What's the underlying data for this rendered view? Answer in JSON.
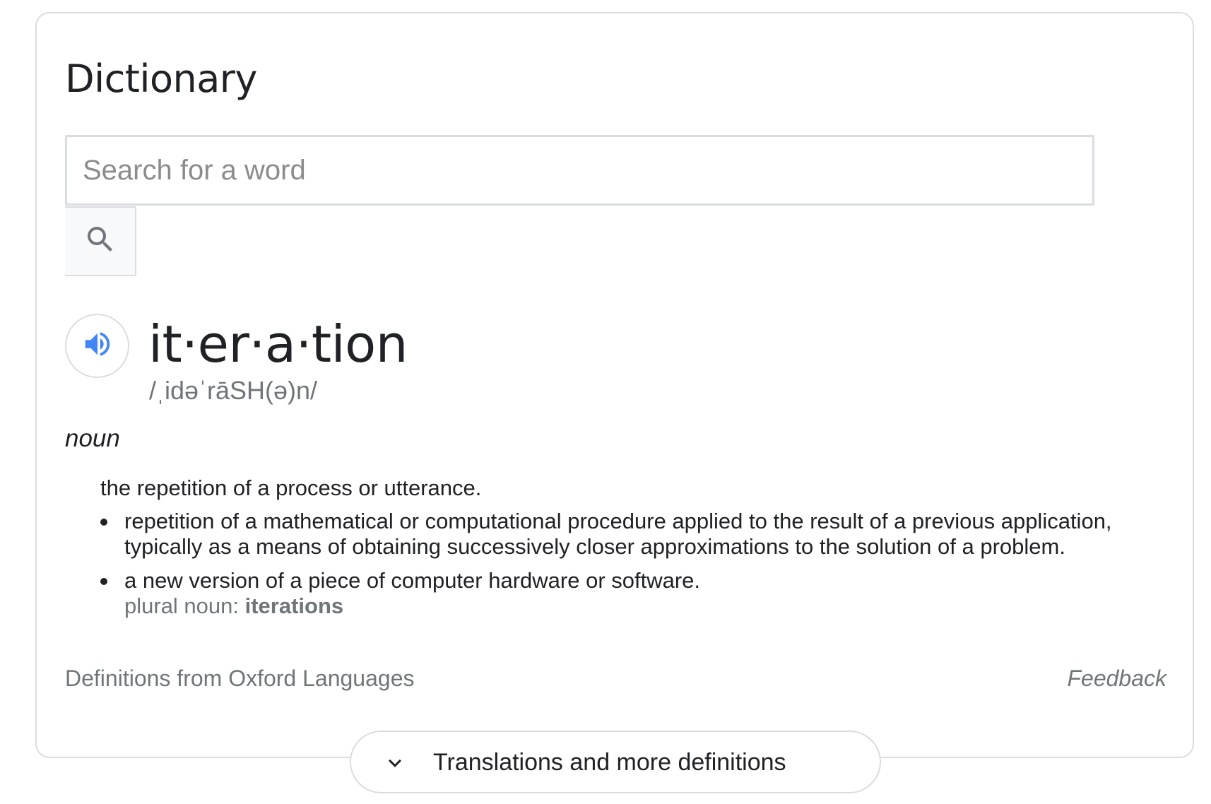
{
  "widget": {
    "title": "Dictionary"
  },
  "search": {
    "placeholder": "Search for a word",
    "value": ""
  },
  "entry": {
    "headword": "it·er·a·tion",
    "phonetic": "/ˌidəˈrāSH(ə)n/",
    "part_of_speech": "noun",
    "main_definition": "the repetition of a process or utterance.",
    "sub_definitions": [
      {
        "text": "repetition of a mathematical or computational procedure applied to the result of a previous application, typically as a means of obtaining successively closer approximations to the solution of a problem."
      },
      {
        "text": "a new version of a piece of computer hardware or software.",
        "plural_label": "plural noun: ",
        "plural_form": "iterations"
      }
    ]
  },
  "footer": {
    "source": "Definitions from Oxford Languages",
    "feedback": "Feedback"
  },
  "more_button": {
    "label": "Translations and more definitions"
  },
  "icons": {
    "search": "search-icon",
    "speaker": "speaker-icon",
    "chevron": "chevron-down-icon"
  },
  "colors": {
    "accent_blue": "#4285f4",
    "border": "#dadce0",
    "secondary_text": "#70757a",
    "primary_text": "#202124"
  }
}
